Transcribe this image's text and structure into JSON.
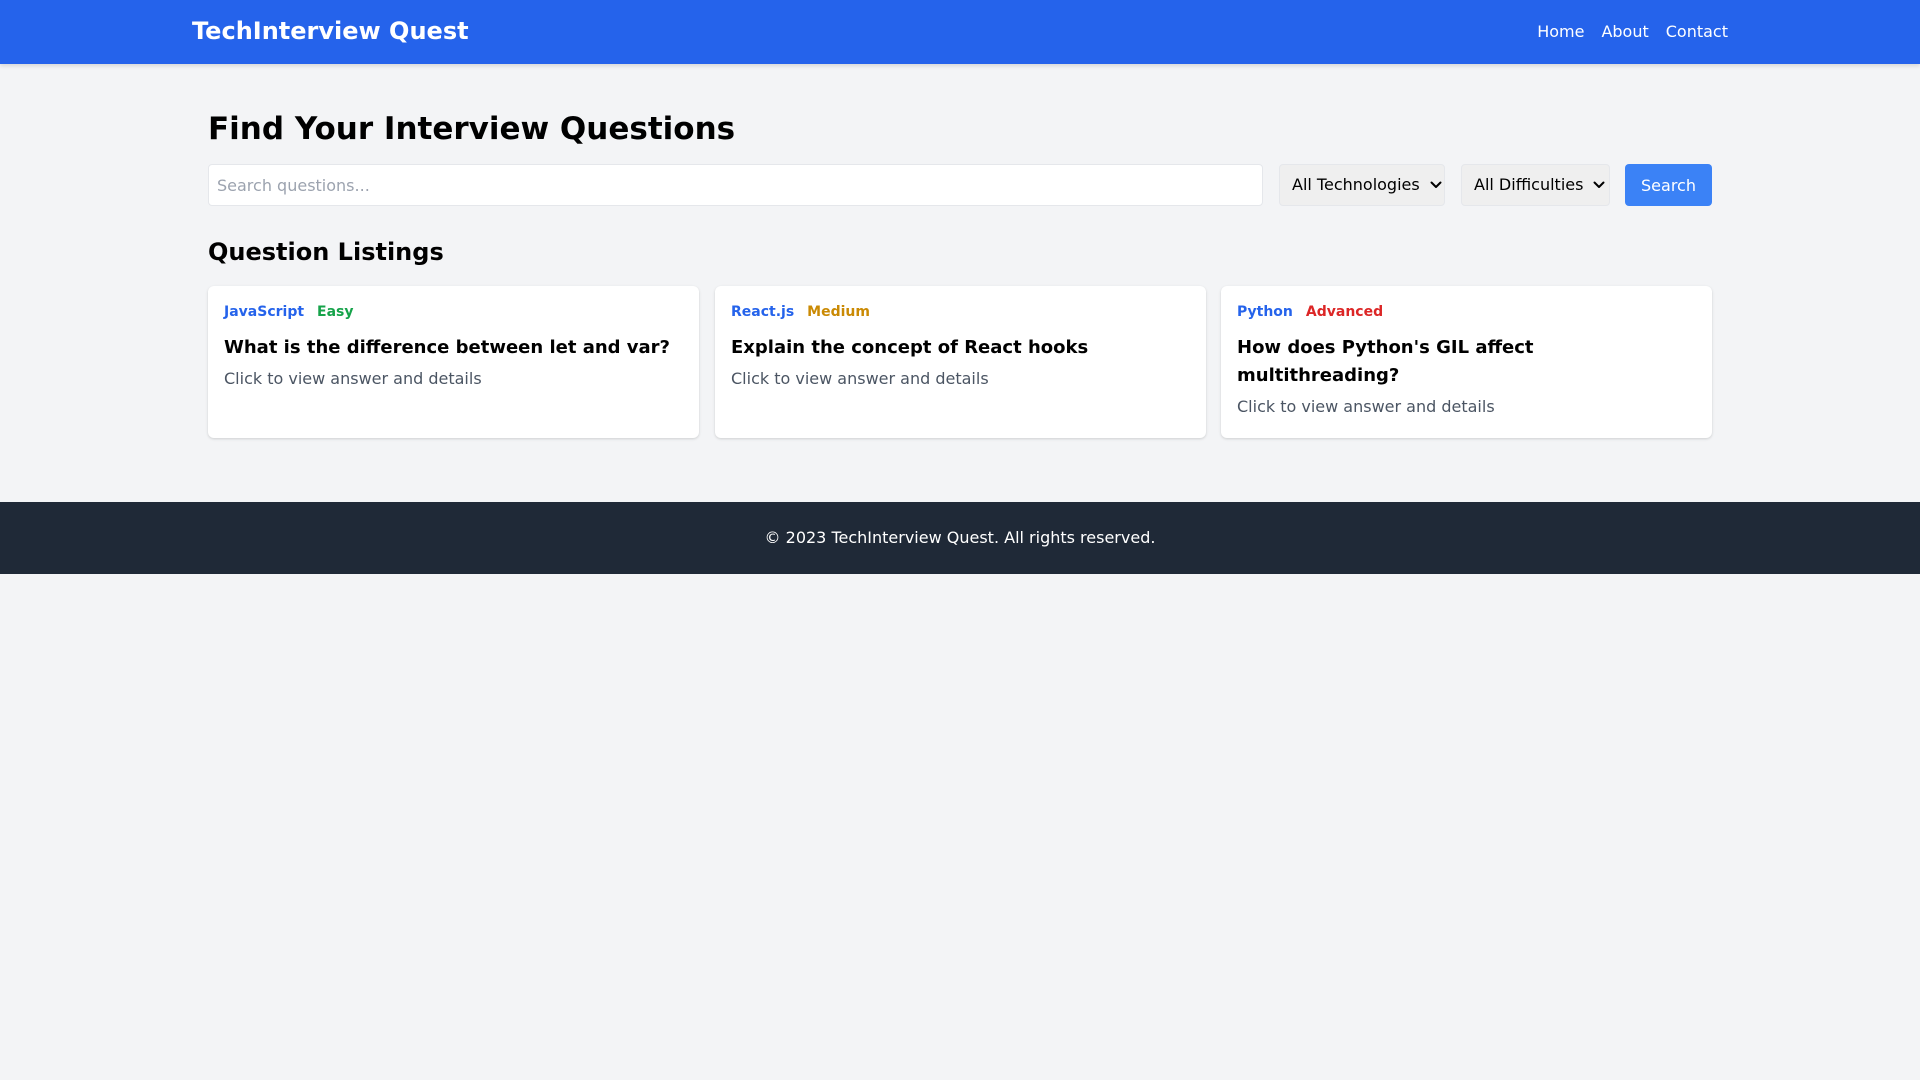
{
  "header": {
    "brand": "TechInterview Quest",
    "nav": [
      {
        "label": "Home"
      },
      {
        "label": "About"
      },
      {
        "label": "Contact"
      }
    ],
    "background_color": "#2563eb"
  },
  "main": {
    "title": "Find Your Interview Questions",
    "search": {
      "placeholder": "Search questions...",
      "value": ""
    },
    "filters": {
      "technology": {
        "selected": "All Technologies",
        "icon": "chevron-down-icon"
      },
      "difficulty": {
        "selected": "All Difficulties",
        "icon": "chevron-down-icon"
      }
    },
    "search_button_label": "Search",
    "search_button_color": "#3b82f6",
    "listings_title": "Question Listings",
    "cards": [
      {
        "technology": "JavaScript",
        "difficulty": "Easy",
        "difficulty_color": "#16a34a",
        "title": "What is the difference between let and var?",
        "description": "Click to view answer and details"
      },
      {
        "technology": "React.js",
        "difficulty": "Medium",
        "difficulty_color": "#ca8a04",
        "title": "Explain the concept of React hooks",
        "description": "Click to view answer and details"
      },
      {
        "technology": "Python",
        "difficulty": "Advanced",
        "difficulty_color": "#dc2626",
        "title": "How does Python's GIL affect multithreading?",
        "description": "Click to view answer and details"
      }
    ]
  },
  "footer": {
    "text": "© 2023 TechInterview Quest. All rights reserved.",
    "background_color": "#1f2937"
  }
}
